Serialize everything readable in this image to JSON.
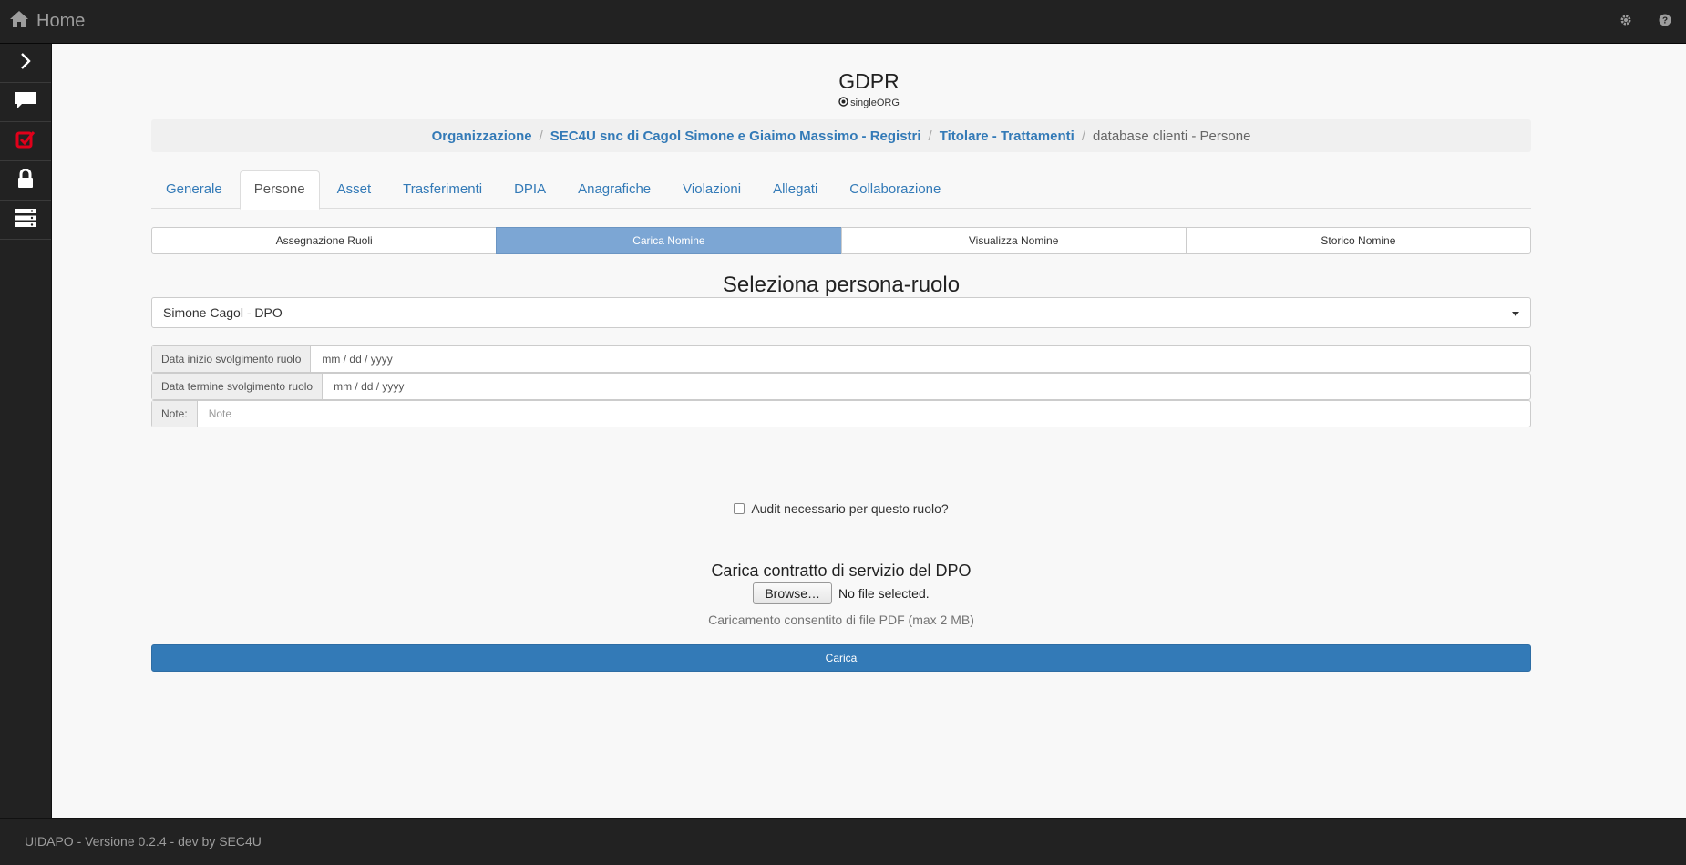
{
  "navbar": {
    "home_label": "Home",
    "icons": [
      "home-icon",
      "gear-icon",
      "help-icon"
    ]
  },
  "sidebar": {
    "items": [
      {
        "icon": "chevron-right-icon"
      },
      {
        "icon": "chat-icon"
      },
      {
        "icon": "checkbox-icon",
        "color": "#e0001a"
      },
      {
        "icon": "lock-icon"
      },
      {
        "icon": "server-icon"
      }
    ]
  },
  "header": {
    "title": "GDPR",
    "subtitle": "singleORG"
  },
  "breadcrumb": {
    "items": [
      "Organizzazione",
      "SEC4U snc di Cagol Simone e Giaimo Massimo - Registri",
      "Titolare - Trattamenti"
    ],
    "current": "database clienti - Persone"
  },
  "tabs": [
    "Generale",
    "Persone",
    "Asset",
    "Trasferimenti",
    "DPIA",
    "Anagrafiche",
    "Violazioni",
    "Allegati",
    "Collaborazione"
  ],
  "active_tab": "Persone",
  "subtabs": [
    "Assegnazione Ruoli",
    "Carica Nomine",
    "Visualizza Nomine",
    "Storico Nomine"
  ],
  "active_subtab": "Carica Nomine",
  "form": {
    "section_title": "Seleziona persona-ruolo",
    "selected_person_role": "Simone Cagol - DPO",
    "start_label": "Data inizio svolgimento ruolo",
    "start_value": "mm / dd / yyyy",
    "end_label": "Data termine svolgimento ruolo",
    "end_value": "mm / dd / yyyy",
    "note_label": "Note:",
    "note_placeholder": "Note",
    "audit_label": "Audit necessario per questo ruolo?",
    "upload_title": "Carica contratto di servizio del DPO",
    "browse_label": "Browse…",
    "no_file_label": "No file selected.",
    "upload_help": "Caricamento consentito di file PDF (max 2 MB)",
    "submit_label": "Carica"
  },
  "footer": {
    "text": "UIDAPO - Versione 0.2.4 - dev by SEC4U"
  },
  "colors": {
    "accent": "#337ab7",
    "subtab_active": "#7ca6d4",
    "dark": "#222222"
  }
}
